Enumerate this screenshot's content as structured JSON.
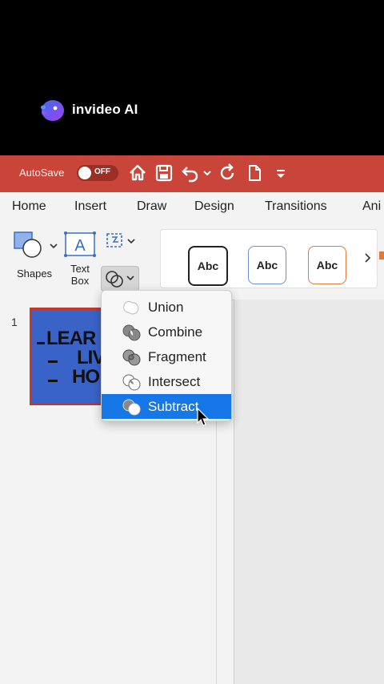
{
  "watermark": {
    "brand": "invideo AI"
  },
  "titlebar": {
    "autosave_label": "AutoSave",
    "toggle_state": "OFF",
    "quick_access_icons": [
      "home-icon",
      "save-icon",
      "undo-icon",
      "undo-dropdown-icon",
      "redo-icon",
      "new-doc-icon",
      "customize-icon"
    ]
  },
  "tabs": [
    "Home",
    "Insert",
    "Draw",
    "Design",
    "Transitions",
    "Ani"
  ],
  "ribbon": {
    "shapes_label": "Shapes",
    "textbox_label_line1": "Text",
    "textbox_label_line2": "Box",
    "style_boxes": [
      "Abc",
      "Abc",
      "Abc"
    ],
    "style_colors": [
      "#222222",
      "#6b8fd6",
      "#e07a3b"
    ]
  },
  "slides": {
    "number": "1",
    "thumb_lines": [
      "LEAR",
      "LIV",
      "HO"
    ]
  },
  "merge_menu": {
    "items": [
      {
        "label": "Union",
        "icon": "union-icon"
      },
      {
        "label": "Combine",
        "icon": "combine-icon"
      },
      {
        "label": "Fragment",
        "icon": "fragment-icon"
      },
      {
        "label": "Intersect",
        "icon": "intersect-icon"
      },
      {
        "label": "Subtract",
        "icon": "subtract-icon"
      }
    ],
    "selected": "Subtract"
  },
  "colors": {
    "titlebar": "#c9453a",
    "selection": "#1677e6",
    "slide_bg": "#3a63c8",
    "slide_border": "#c0392b"
  }
}
